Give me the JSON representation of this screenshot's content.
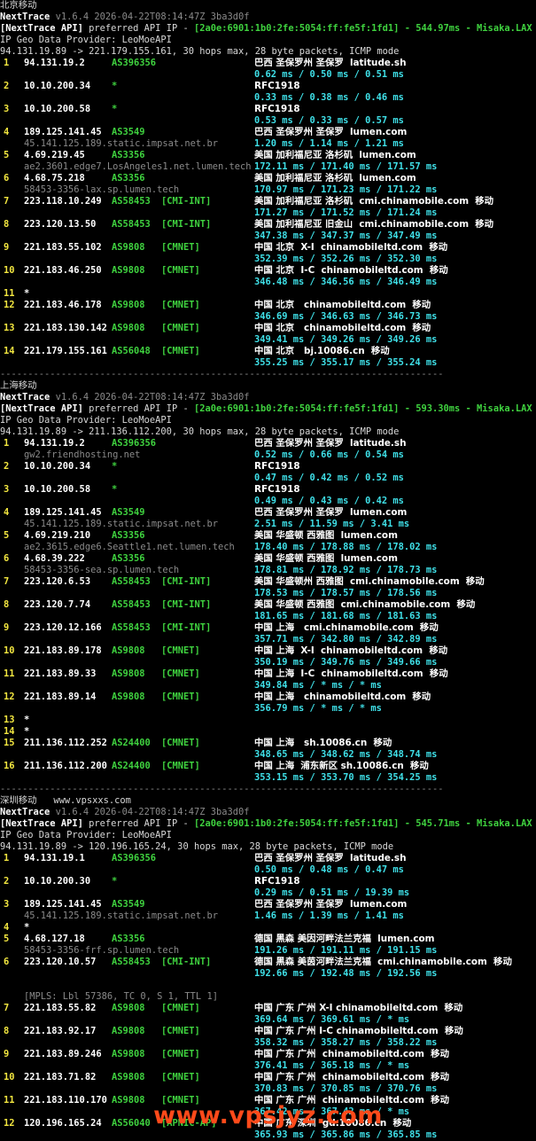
{
  "colors": {
    "background": "#000000",
    "hop": "#f2e640",
    "asn": "#3fd23f",
    "rtt": "#3fe0e8",
    "rdns": "#8a8a8a",
    "watermark": "#ff4a1a"
  },
  "watermark": "www.vpsjyz.com",
  "traces": [
    {
      "title": "北京移动",
      "site": "",
      "app_name": "NextTrace",
      "version_line": "v1.6.4 2026-04-22T08:14:47Z 3ba3d0f",
      "api_tag": "[NextTrace API]",
      "api_text": "preferred API IP - ",
      "api_ip": "[2a0e:6901:1b0:2fe:5054:ff:fe5f:1fd1]",
      "api_latency": "- 544.97ms -",
      "api_node": "Misaka.LAX",
      "geo_provider": "IP Geo Data Provider: LeoMoeAPI",
      "route": "94.131.19.89 -> 221.179.155.161, 30 hops max, 28 byte packets, ICMP mode",
      "hops": [
        {
          "n": "1",
          "ip": "94.131.19.2",
          "asn": "AS396356",
          "tag": "",
          "geo": "巴西 圣保罗州 圣保罗  latitude.sh",
          "rdns": "",
          "rtt": "0.62 ms / 0.50 ms / 0.51 ms",
          "extra": ""
        },
        {
          "n": "2",
          "ip": "10.10.200.34",
          "asn": "*",
          "tag": "",
          "geo": "RFC1918",
          "rdns": "",
          "rtt": "0.33 ms / 0.38 ms / 0.46 ms",
          "extra": ""
        },
        {
          "n": "3",
          "ip": "10.10.200.58",
          "asn": "*",
          "tag": "",
          "geo": "RFC1918",
          "rdns": "",
          "rtt": "0.53 ms / 0.33 ms / 0.57 ms",
          "extra": ""
        },
        {
          "n": "4",
          "ip": "189.125.141.45",
          "asn": "AS3549",
          "tag": "",
          "geo": "巴西 圣保罗州 圣保罗  lumen.com",
          "rdns": "45.141.125.189.static.impsat.net.br",
          "rtt": "1.20 ms / 1.14 ms / 1.21 ms",
          "extra": ""
        },
        {
          "n": "5",
          "ip": "4.69.219.45",
          "asn": "AS3356",
          "tag": "",
          "geo": "美国 加利福尼亚 洛杉矶  lumen.com",
          "rdns": "ae2.3601.edge7.LosAngeles1.net.lumen.tech",
          "rtt": "172.11 ms / 171.40 ms / 171.57 ms",
          "extra": ""
        },
        {
          "n": "6",
          "ip": "4.68.75.218",
          "asn": "AS3356",
          "tag": "",
          "geo": "美国 加利福尼亚 洛杉矶  lumen.com",
          "rdns": "58453-3356-lax.sp.lumen.tech",
          "rtt": "170.97 ms / 171.23 ms / 171.22 ms",
          "extra": ""
        },
        {
          "n": "7",
          "ip": "223.118.10.249",
          "asn": "AS58453",
          "tag": "[CMI-INT]",
          "geo": "美国 加利福尼亚 洛杉矶  cmi.chinamobile.com  移动",
          "rdns": "",
          "rtt": "171.27 ms / 171.52 ms / 171.24 ms",
          "extra": ""
        },
        {
          "n": "8",
          "ip": "223.120.13.50",
          "asn": "AS58453",
          "tag": "[CMI-INT]",
          "geo": "美国 加利福尼亚 旧金山  cmi.chinamobile.com  移动",
          "rdns": "",
          "rtt": "347.38 ms / 347.37 ms / 347.49 ms",
          "extra": ""
        },
        {
          "n": "9",
          "ip": "221.183.55.102",
          "asn": "AS9808",
          "tag": "[CMNET]",
          "geo": "中国 北京  X-I  chinamobileltd.com  移动",
          "rdns": "",
          "rtt": "352.39 ms / 352.26 ms / 352.30 ms",
          "extra": ""
        },
        {
          "n": "10",
          "ip": "221.183.46.250",
          "asn": "AS9808",
          "tag": "[CMNET]",
          "geo": "中国 北京  I-C  chinamobileltd.com  移动",
          "rdns": "",
          "rtt": "346.48 ms / 346.56 ms / 346.49 ms",
          "extra": ""
        },
        {
          "n": "11",
          "ip": "*",
          "asn": "",
          "tag": "",
          "geo": "",
          "rdns": "",
          "rtt": "",
          "extra": ""
        },
        {
          "n": "12",
          "ip": "221.183.46.178",
          "asn": "AS9808",
          "tag": "[CMNET]",
          "geo": "中国 北京   chinamobileltd.com  移动",
          "rdns": "",
          "rtt": "346.69 ms / 346.63 ms / 346.73 ms",
          "extra": ""
        },
        {
          "n": "13",
          "ip": "221.183.130.142",
          "asn": "AS9808",
          "tag": "[CMNET]",
          "geo": "中国 北京   chinamobileltd.com  移动",
          "rdns": "",
          "rtt": "349.41 ms / 349.26 ms / 349.26 ms",
          "extra": ""
        },
        {
          "n": "14",
          "ip": "221.179.155.161",
          "asn": "AS56048",
          "tag": "[CMNET]",
          "geo": "中国 北京   bj.10086.cn  移动",
          "rdns": "",
          "rtt": "355.25 ms / 355.17 ms / 355.24 ms",
          "extra": ""
        }
      ]
    },
    {
      "title": "上海移动",
      "site": "",
      "app_name": "NextTrace",
      "version_line": "v1.6.4 2026-04-22T08:14:47Z 3ba3d0f",
      "api_tag": "[NextTrace API]",
      "api_text": "preferred API IP - ",
      "api_ip": "[2a0e:6901:1b0:2fe:5054:ff:fe5f:1fd1]",
      "api_latency": "- 593.30ms -",
      "api_node": "Misaka.LAX",
      "geo_provider": "IP Geo Data Provider: LeoMoeAPI",
      "route": "94.131.19.89 -> 211.136.112.200, 30 hops max, 28 byte packets, ICMP mode",
      "hops": [
        {
          "n": "1",
          "ip": "94.131.19.2",
          "asn": "AS396356",
          "tag": "",
          "geo": "巴西 圣保罗州 圣保罗  latitude.sh",
          "rdns": "gw2.friendhosting.net",
          "rtt": "0.52 ms / 0.66 ms / 0.54 ms",
          "extra": ""
        },
        {
          "n": "2",
          "ip": "10.10.200.34",
          "asn": "*",
          "tag": "",
          "geo": "RFC1918",
          "rdns": "",
          "rtt": "0.47 ms / 0.42 ms / 0.52 ms",
          "extra": ""
        },
        {
          "n": "3",
          "ip": "10.10.200.58",
          "asn": "*",
          "tag": "",
          "geo": "RFC1918",
          "rdns": "",
          "rtt": "0.49 ms / 0.43 ms / 0.42 ms",
          "extra": ""
        },
        {
          "n": "4",
          "ip": "189.125.141.45",
          "asn": "AS3549",
          "tag": "",
          "geo": "巴西 圣保罗州 圣保罗  lumen.com",
          "rdns": "45.141.125.189.static.impsat.net.br",
          "rtt": "2.51 ms / 11.59 ms / 3.41 ms",
          "extra": ""
        },
        {
          "n": "5",
          "ip": "4.69.219.210",
          "asn": "AS3356",
          "tag": "",
          "geo": "美国 华盛顿 西雅图  lumen.com",
          "rdns": "ae2.3615.edge6.Seattle1.net.lumen.tech",
          "rtt": "178.40 ms / 178.88 ms / 178.02 ms",
          "extra": ""
        },
        {
          "n": "6",
          "ip": "4.68.39.222",
          "asn": "AS3356",
          "tag": "",
          "geo": "美国 华盛顿 西雅图  lumen.com",
          "rdns": "58453-3356-sea.sp.lumen.tech",
          "rtt": "178.81 ms / 178.92 ms / 178.73 ms",
          "extra": ""
        },
        {
          "n": "7",
          "ip": "223.120.6.53",
          "asn": "AS58453",
          "tag": "[CMI-INT]",
          "geo": "美国 华盛顿州 西雅图  cmi.chinamobile.com  移动",
          "rdns": "",
          "rtt": "178.53 ms / 178.57 ms / 178.56 ms",
          "extra": ""
        },
        {
          "n": "8",
          "ip": "223.120.7.74",
          "asn": "AS58453",
          "tag": "[CMI-INT]",
          "geo": "美国 华盛顿 西雅图  cmi.chinamobile.com  移动",
          "rdns": "",
          "rtt": "181.65 ms / 181.68 ms / 181.63 ms",
          "extra": ""
        },
        {
          "n": "9",
          "ip": "223.120.12.166",
          "asn": "AS58453",
          "tag": "[CMI-INT]",
          "geo": "中国 上海   cmi.chinamobile.com  移动",
          "rdns": "",
          "rtt": "357.71 ms / 342.80 ms / 342.89 ms",
          "extra": ""
        },
        {
          "n": "10",
          "ip": "221.183.89.178",
          "asn": "AS9808",
          "tag": "[CMNET]",
          "geo": "中国 上海  X-I  chinamobileltd.com  移动",
          "rdns": "",
          "rtt": "350.19 ms / 349.76 ms / 349.66 ms",
          "extra": ""
        },
        {
          "n": "11",
          "ip": "221.183.89.33",
          "asn": "AS9808",
          "tag": "[CMNET]",
          "geo": "中国 上海  I-C  chinamobileltd.com  移动",
          "rdns": "",
          "rtt": "349.84 ms / * ms / * ms",
          "extra": ""
        },
        {
          "n": "12",
          "ip": "221.183.89.14",
          "asn": "AS9808",
          "tag": "[CMNET]",
          "geo": "中国 上海   chinamobileltd.com  移动",
          "rdns": "",
          "rtt": "356.79 ms / * ms / * ms",
          "extra": ""
        },
        {
          "n": "13",
          "ip": "*",
          "asn": "",
          "tag": "",
          "geo": "",
          "rdns": "",
          "rtt": "",
          "extra": ""
        },
        {
          "n": "14",
          "ip": "*",
          "asn": "",
          "tag": "",
          "geo": "",
          "rdns": "",
          "rtt": "",
          "extra": ""
        },
        {
          "n": "15",
          "ip": "211.136.112.252",
          "asn": "AS24400",
          "tag": "[CMNET]",
          "geo": "中国 上海   sh.10086.cn  移动",
          "rdns": "",
          "rtt": "348.65 ms / 348.62 ms / 348.74 ms",
          "extra": ""
        },
        {
          "n": "16",
          "ip": "211.136.112.200",
          "asn": "AS24400",
          "tag": "[CMNET]",
          "geo": "中国 上海  浦东新区 sh.10086.cn  移动",
          "rdns": "",
          "rtt": "353.15 ms / 353.70 ms / 354.25 ms",
          "extra": ""
        }
      ]
    },
    {
      "title": "深圳移动",
      "site": "www.vpsxxs.com",
      "app_name": "NextTrace",
      "version_line": "v1.6.4 2026-04-22T08:14:47Z 3ba3d0f",
      "api_tag": "[NextTrace API]",
      "api_text": "preferred API IP - ",
      "api_ip": "[2a0e:6901:1b0:2fe:5054:ff:fe5f:1fd1]",
      "api_latency": "- 545.71ms -",
      "api_node": "Misaka.LAX",
      "geo_provider": "IP Geo Data Provider: LeoMoeAPI",
      "route": "94.131.19.89 -> 120.196.165.24, 30 hops max, 28 byte packets, ICMP mode",
      "hops": [
        {
          "n": "1",
          "ip": "94.131.19.1",
          "asn": "AS396356",
          "tag": "",
          "geo": "巴西 圣保罗州 圣保罗  latitude.sh",
          "rdns": "",
          "rtt": "0.50 ms / 0.48 ms / 0.47 ms",
          "extra": ""
        },
        {
          "n": "2",
          "ip": "10.10.200.30",
          "asn": "*",
          "tag": "",
          "geo": "RFC1918",
          "rdns": "",
          "rtt": "0.29 ms / 0.51 ms / 19.39 ms",
          "extra": ""
        },
        {
          "n": "3",
          "ip": "189.125.141.45",
          "asn": "AS3549",
          "tag": "",
          "geo": "巴西 圣保罗州 圣保罗  lumen.com",
          "rdns": "45.141.125.189.static.impsat.net.br",
          "rtt": "1.46 ms / 1.39 ms / 1.41 ms",
          "extra": ""
        },
        {
          "n": "4",
          "ip": "*",
          "asn": "",
          "tag": "",
          "geo": "",
          "rdns": "",
          "rtt": "",
          "extra": ""
        },
        {
          "n": "5",
          "ip": "4.68.127.18",
          "asn": "AS3356",
          "tag": "",
          "geo": "德国 黑森 美因河畔法兰克福  lumen.com",
          "rdns": "58453-3356-frf.sp.lumen.tech",
          "rtt": "191.26 ms / 191.11 ms / 191.15 ms",
          "extra": ""
        },
        {
          "n": "6",
          "ip": "223.120.10.57",
          "asn": "AS58453",
          "tag": "[CMI-INT]",
          "geo": "德国 黑森 美茵河畔法兰克福  cmi.chinamobile.com  移动",
          "rdns": "",
          "rtt": "192.66 ms / 192.48 ms / 192.56 ms",
          "extra": "[MPLS: Lbl 57386, TC 0, S 1, TTL 1]"
        },
        {
          "n": "7",
          "ip": "221.183.55.82",
          "asn": "AS9808",
          "tag": "[CMNET]",
          "geo": "中国 广东 广州 X-I chinamobileltd.com  移动",
          "rdns": "",
          "rtt": "369.64 ms / 369.61 ms / * ms",
          "extra": ""
        },
        {
          "n": "8",
          "ip": "221.183.92.17",
          "asn": "AS9808",
          "tag": "[CMNET]",
          "geo": "中国 广东 广州 I-C chinamobileltd.com  移动",
          "rdns": "",
          "rtt": "358.32 ms / 358.27 ms / 358.22 ms",
          "extra": ""
        },
        {
          "n": "9",
          "ip": "221.183.89.246",
          "asn": "AS9808",
          "tag": "[CMNET]",
          "geo": "中国 广东 广州  chinamobileltd.com  移动",
          "rdns": "",
          "rtt": "376.41 ms / 365.18 ms / * ms",
          "extra": ""
        },
        {
          "n": "10",
          "ip": "221.183.71.82",
          "asn": "AS9808",
          "tag": "[CMNET]",
          "geo": "中国 广东 广州  chinamobileltd.com  移动",
          "rdns": "",
          "rtt": "370.83 ms / 370.85 ms / 370.76 ms",
          "extra": ""
        },
        {
          "n": "11",
          "ip": "221.183.110.170",
          "asn": "AS9808",
          "tag": "[CMNET]",
          "geo": "中国 广东 广州  chinamobileltd.com  移动",
          "rdns": "",
          "rtt": "367.42 ms / 367.42 ms / * ms",
          "extra": ""
        },
        {
          "n": "12",
          "ip": "120.196.165.24",
          "asn": "AS56040",
          "tag": "[APNIC-AP]",
          "geo": "中国 广东 深圳  gd.10086.cn  移动",
          "rdns": "",
          "rtt": "365.93 ms / 365.86 ms / 365.85 ms",
          "extra": ""
        }
      ]
    }
  ],
  "separator": "--------------------------------------------------------------------------------"
}
